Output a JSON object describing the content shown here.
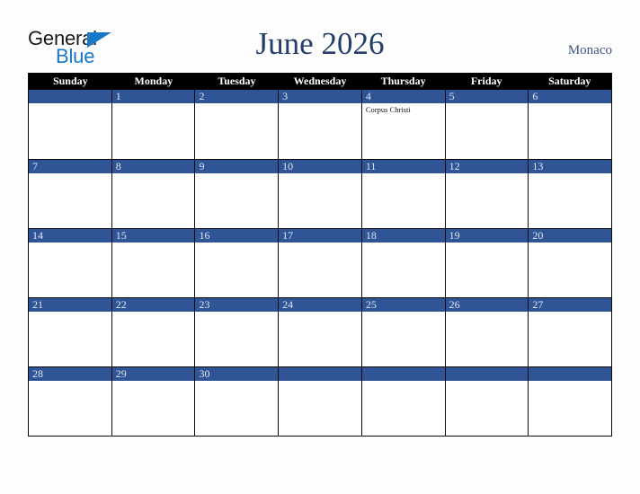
{
  "brand": {
    "word_primary": "General",
    "word_secondary": "Blue",
    "triangle_color": "#1878c8",
    "primary_color": "#1b1b1b"
  },
  "header": {
    "title": "June 2026",
    "region": "Monaco",
    "title_color": "#243e6b",
    "region_color": "#3f5680"
  },
  "calendar": {
    "month": "June",
    "year": "2026",
    "header_background": "#000000",
    "date_bar_color": "#2f5596",
    "date_text_color": "#dfe6f2",
    "grid_line_color": "#0a0a0a",
    "weekdays": [
      "Sunday",
      "Monday",
      "Tuesday",
      "Wednesday",
      "Thursday",
      "Friday",
      "Saturday"
    ],
    "weeks": [
      [
        {
          "day": "",
          "events": []
        },
        {
          "day": "1",
          "events": []
        },
        {
          "day": "2",
          "events": []
        },
        {
          "day": "3",
          "events": []
        },
        {
          "day": "4",
          "events": [
            "Corpus Christi"
          ]
        },
        {
          "day": "5",
          "events": []
        },
        {
          "day": "6",
          "events": []
        }
      ],
      [
        {
          "day": "7",
          "events": []
        },
        {
          "day": "8",
          "events": []
        },
        {
          "day": "9",
          "events": []
        },
        {
          "day": "10",
          "events": []
        },
        {
          "day": "11",
          "events": []
        },
        {
          "day": "12",
          "events": []
        },
        {
          "day": "13",
          "events": []
        }
      ],
      [
        {
          "day": "14",
          "events": []
        },
        {
          "day": "15",
          "events": []
        },
        {
          "day": "16",
          "events": []
        },
        {
          "day": "17",
          "events": []
        },
        {
          "day": "18",
          "events": []
        },
        {
          "day": "19",
          "events": []
        },
        {
          "day": "20",
          "events": []
        }
      ],
      [
        {
          "day": "21",
          "events": []
        },
        {
          "day": "22",
          "events": []
        },
        {
          "day": "23",
          "events": []
        },
        {
          "day": "24",
          "events": []
        },
        {
          "day": "25",
          "events": []
        },
        {
          "day": "26",
          "events": []
        },
        {
          "day": "27",
          "events": []
        }
      ],
      [
        {
          "day": "28",
          "events": []
        },
        {
          "day": "29",
          "events": []
        },
        {
          "day": "30",
          "events": []
        },
        {
          "day": "",
          "events": []
        },
        {
          "day": "",
          "events": []
        },
        {
          "day": "",
          "events": []
        },
        {
          "day": "",
          "events": []
        }
      ]
    ]
  }
}
